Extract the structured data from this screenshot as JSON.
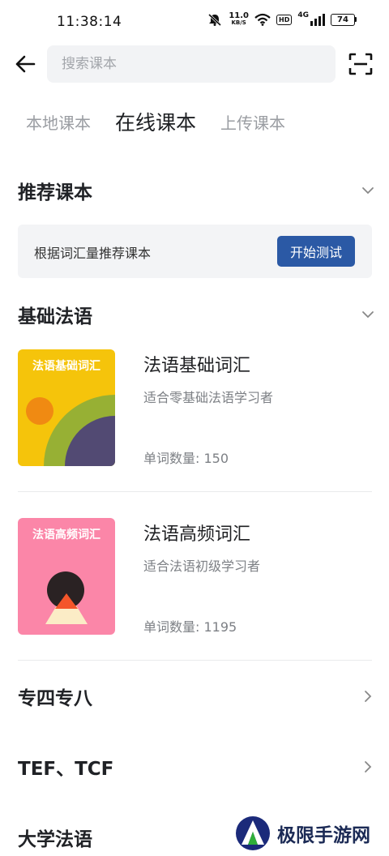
{
  "status_bar": {
    "time": "11:38:14",
    "net_speed_value": "11.0",
    "net_speed_unit": "KB/S",
    "hd": "HD",
    "network": "4G",
    "battery": "74"
  },
  "search": {
    "placeholder": "搜索课本"
  },
  "tabs": [
    {
      "label": "本地课本",
      "active": false
    },
    {
      "label": "在线课本",
      "active": true
    },
    {
      "label": "上传课本",
      "active": false
    }
  ],
  "recommend": {
    "title": "推荐课本",
    "description": "根据词汇量推荐课本",
    "button": "开始测试"
  },
  "basic_french": {
    "title": "基础法语",
    "books": [
      {
        "cover_title": "法语基础词汇",
        "title": "法语基础词汇",
        "description": "适合零基础法语学习者",
        "word_count": "单词数量: 150"
      },
      {
        "cover_title": "法语高频词汇",
        "title": "法语高频词汇",
        "description": "适合法语初级学习者",
        "word_count": "单词数量: 1195"
      }
    ]
  },
  "categories": [
    {
      "label": "专四专八"
    },
    {
      "label": "TEF、TCF"
    },
    {
      "label": "大学法语"
    }
  ],
  "watermark": {
    "text": "极限手游网"
  },
  "colors": {
    "accent_button": "#2b59a5",
    "cover_yellow": "#f5c40b",
    "cover_pink": "#fb86a8"
  }
}
